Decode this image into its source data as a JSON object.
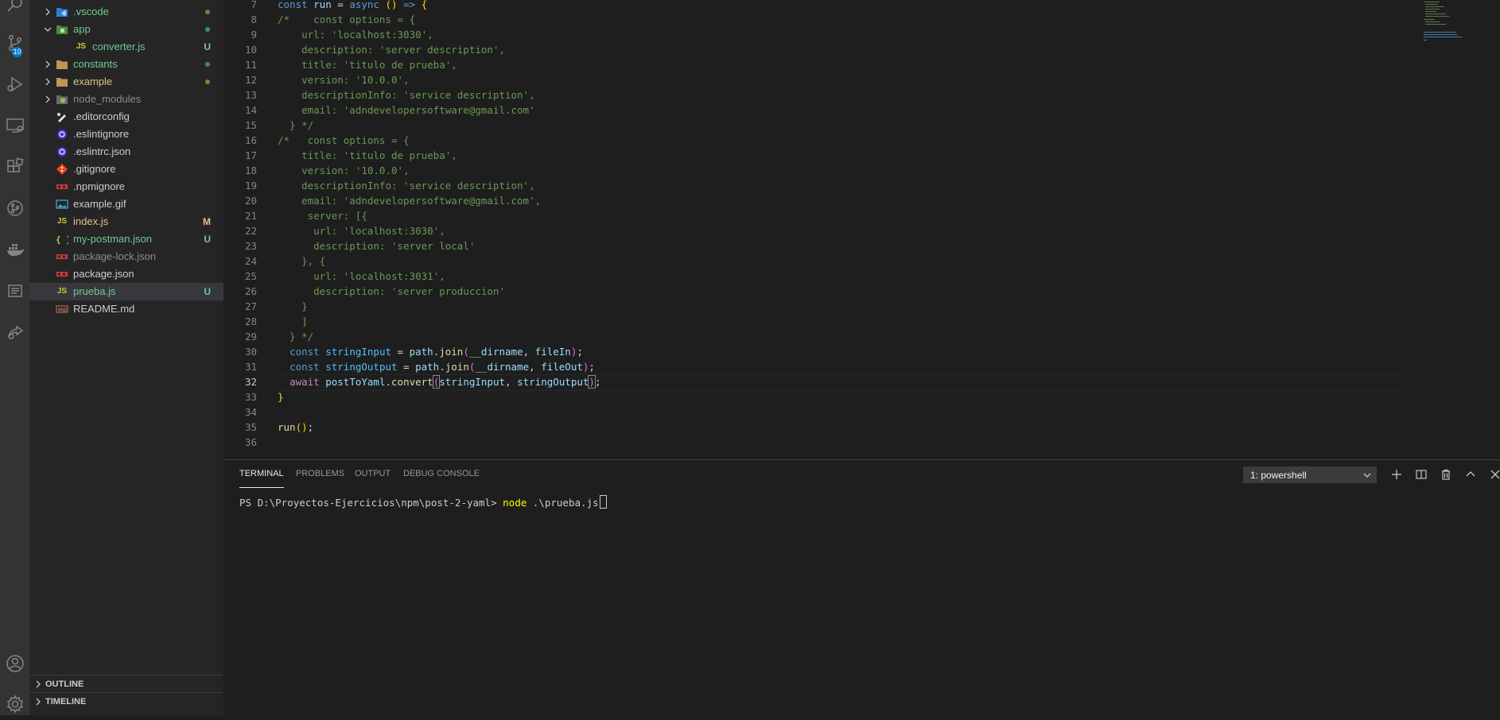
{
  "activity_bar": {
    "items": [
      {
        "icon": "search-icon"
      },
      {
        "icon": "source-control-icon",
        "badge": "10"
      },
      {
        "icon": "run-debug-icon"
      },
      {
        "icon": "remote-explorer-icon"
      },
      {
        "icon": "extensions-icon"
      },
      {
        "icon": "git-graph-icon"
      },
      {
        "icon": "docker-icon"
      },
      {
        "icon": "notes-icon"
      },
      {
        "icon": "live-share-icon"
      }
    ],
    "bottom": [
      {
        "icon": "account-icon"
      },
      {
        "icon": "settings-gear-icon"
      }
    ]
  },
  "explorer": {
    "items": [
      {
        "name": ".vscode",
        "type": "folder",
        "icon": "vscode-folder-icon",
        "color": "green",
        "status_dot": "#8b7a3d"
      },
      {
        "name": "app",
        "type": "folder-open",
        "icon": "app-folder-icon",
        "color": "green",
        "status_dot": "#3f8f5e"
      },
      {
        "name": "converter.js",
        "type": "file",
        "icon": "js-file-icon",
        "color": "green",
        "status": "U",
        "indent": 1
      },
      {
        "name": "constants",
        "type": "folder",
        "icon": "folder-icon",
        "color": "green",
        "status_dot": "#3f8f5e"
      },
      {
        "name": "example",
        "type": "folder",
        "icon": "folder-icon",
        "color": "yellow",
        "status_dot": "#8b7a3d"
      },
      {
        "name": "node_modules",
        "type": "folder",
        "icon": "node-folder-icon",
        "color": "dim"
      },
      {
        "name": ".editorconfig",
        "type": "file",
        "icon": "editorconfig-icon",
        "color": "norm"
      },
      {
        "name": ".eslintignore",
        "type": "file",
        "icon": "eslint-icon",
        "color": "norm"
      },
      {
        "name": ".eslintrc.json",
        "type": "file",
        "icon": "eslint-icon",
        "color": "norm"
      },
      {
        "name": ".gitignore",
        "type": "file",
        "icon": "git-icon",
        "color": "norm"
      },
      {
        "name": ".npmignore",
        "type": "file",
        "icon": "npm-icon",
        "color": "norm"
      },
      {
        "name": "example.gif",
        "type": "file",
        "icon": "image-icon",
        "color": "norm"
      },
      {
        "name": "index.js",
        "type": "file",
        "icon": "js-file-icon",
        "color": "yellow",
        "status": "M"
      },
      {
        "name": "my-postman.json",
        "type": "file",
        "icon": "json-icon",
        "color": "green",
        "status": "U"
      },
      {
        "name": "package-lock.json",
        "type": "file",
        "icon": "npm-icon",
        "color": "dim"
      },
      {
        "name": "package.json",
        "type": "file",
        "icon": "npm-icon",
        "color": "norm"
      },
      {
        "name": "prueba.js",
        "type": "file",
        "icon": "js-file-icon",
        "color": "green",
        "status": "U",
        "selected": true
      },
      {
        "name": "README.md",
        "type": "file",
        "icon": "markdown-icon",
        "color": "norm"
      }
    ],
    "outline_label": "OUTLINE",
    "timeline_label": "TIMELINE"
  },
  "editor": {
    "lines": [
      {
        "n": "7",
        "t": [
          [
            "kw",
            "const "
          ],
          [
            "var",
            "run"
          ],
          [
            "pl",
            " = "
          ],
          [
            "kw",
            "async "
          ],
          [
            "p",
            "("
          ],
          [
            "p",
            ")"
          ],
          [
            "pl",
            " "
          ],
          [
            "kw",
            "=>"
          ],
          [
            "pl",
            " "
          ],
          [
            "p",
            "{"
          ]
        ]
      },
      {
        "n": "8",
        "t": [
          [
            "com",
            "/*    const options = {"
          ]
        ]
      },
      {
        "n": "9",
        "t": [
          [
            "com",
            "    url: 'localhost:3030',"
          ]
        ]
      },
      {
        "n": "10",
        "t": [
          [
            "com",
            "    description: 'server description',"
          ]
        ]
      },
      {
        "n": "11",
        "t": [
          [
            "com",
            "    title: 'titulo de prueba',"
          ]
        ]
      },
      {
        "n": "12",
        "t": [
          [
            "com",
            "    version: '10.0.0',"
          ]
        ]
      },
      {
        "n": "13",
        "t": [
          [
            "com",
            "    descriptionInfo: 'service description',"
          ]
        ]
      },
      {
        "n": "14",
        "t": [
          [
            "com",
            "    email: 'adndevelopersoftware@gmail.com'"
          ]
        ]
      },
      {
        "n": "15",
        "t": [
          [
            "com",
            "  } */"
          ]
        ]
      },
      {
        "n": "16",
        "t": [
          [
            "com",
            "/*   const options = {"
          ]
        ]
      },
      {
        "n": "17",
        "t": [
          [
            "com",
            "    title: 'titulo de prueba',"
          ]
        ]
      },
      {
        "n": "18",
        "t": [
          [
            "com",
            "    version: '10.0.0',"
          ]
        ]
      },
      {
        "n": "19",
        "t": [
          [
            "com",
            "    descriptionInfo: 'service description',"
          ]
        ]
      },
      {
        "n": "20",
        "t": [
          [
            "com",
            "    email: 'adndevelopersoftware@gmail.com',"
          ]
        ]
      },
      {
        "n": "21",
        "t": [
          [
            "com",
            "     server: [{"
          ]
        ]
      },
      {
        "n": "22",
        "t": [
          [
            "com",
            "      url: 'localhost:3030',"
          ]
        ]
      },
      {
        "n": "23",
        "t": [
          [
            "com",
            "      description: 'server local'"
          ]
        ]
      },
      {
        "n": "24",
        "t": [
          [
            "com",
            "    }, {"
          ]
        ]
      },
      {
        "n": "25",
        "t": [
          [
            "com",
            "      url: 'localhost:3031',"
          ]
        ]
      },
      {
        "n": "26",
        "t": [
          [
            "com",
            "      description: 'server produccion'"
          ]
        ]
      },
      {
        "n": "27",
        "t": [
          [
            "com",
            "    }"
          ]
        ]
      },
      {
        "n": "28",
        "t": [
          [
            "com",
            "    ]"
          ]
        ]
      },
      {
        "n": "29",
        "t": [
          [
            "com",
            "  } */"
          ]
        ]
      },
      {
        "n": "30",
        "t": [
          [
            "pl",
            "  "
          ],
          [
            "kw",
            "const "
          ],
          [
            "const",
            "stringInput"
          ],
          [
            "pl",
            " = "
          ],
          [
            "var",
            "path"
          ],
          [
            "pl",
            "."
          ],
          [
            "fn",
            "join"
          ],
          [
            "p2",
            "("
          ],
          [
            "var",
            "__dirname"
          ],
          [
            "pl",
            ", "
          ],
          [
            "var",
            "fileIn"
          ],
          [
            "p2",
            ")"
          ],
          [
            "pl",
            ";"
          ]
        ]
      },
      {
        "n": "31",
        "t": [
          [
            "pl",
            "  "
          ],
          [
            "kw",
            "const "
          ],
          [
            "const",
            "stringOutput"
          ],
          [
            "pl",
            " = "
          ],
          [
            "var",
            "path"
          ],
          [
            "pl",
            "."
          ],
          [
            "fn",
            "join"
          ],
          [
            "p2",
            "("
          ],
          [
            "var",
            "__dirname"
          ],
          [
            "pl",
            ", "
          ],
          [
            "var",
            "fileOut"
          ],
          [
            "p2",
            ")"
          ],
          [
            "pl",
            ";"
          ]
        ]
      },
      {
        "n": "32",
        "t": [
          [
            "pl",
            "  "
          ],
          [
            "ctl",
            "await "
          ],
          [
            "var",
            "postToYaml"
          ],
          [
            "pl",
            "."
          ],
          [
            "fn",
            "convert"
          ],
          [
            "p2b",
            "("
          ],
          [
            "var",
            "stringInput"
          ],
          [
            "pl",
            ", "
          ],
          [
            "var",
            "stringOutput"
          ],
          [
            "p2b",
            ")"
          ],
          [
            "pl",
            ";"
          ]
        ],
        "active": true
      },
      {
        "n": "33",
        "t": [
          [
            "p",
            "}"
          ]
        ]
      },
      {
        "n": "34",
        "t": []
      },
      {
        "n": "35",
        "t": [
          [
            "fn",
            "run"
          ],
          [
            "p",
            "("
          ],
          [
            "p",
            ")"
          ],
          [
            "pl",
            ";"
          ]
        ]
      },
      {
        "n": "36",
        "t": []
      }
    ]
  },
  "panel": {
    "tabs": [
      {
        "label": "TERMINAL",
        "active": true
      },
      {
        "label": "PROBLEMS",
        "active": false
      },
      {
        "label": "OUTPUT",
        "active": false
      },
      {
        "label": "DEBUG CONSOLE",
        "active": false
      }
    ],
    "terminal_select": "1: powershell",
    "buttons": [
      "new-terminal-icon",
      "split-terminal-icon",
      "kill-terminal-icon",
      "maximize-panel-icon",
      "close-panel-icon"
    ],
    "prompt": "PS D:\\Proyectos-Ejercicios\\npm\\post-2-yaml> ",
    "command": "node",
    "args": " .\\prueba.js"
  },
  "colors": {
    "activity_bar": "#333333",
    "sidebar": "#252526",
    "editor": "#1e1e1e",
    "accent": "#007acc",
    "untracked": "#73c991",
    "modified": "#e2c08d"
  }
}
